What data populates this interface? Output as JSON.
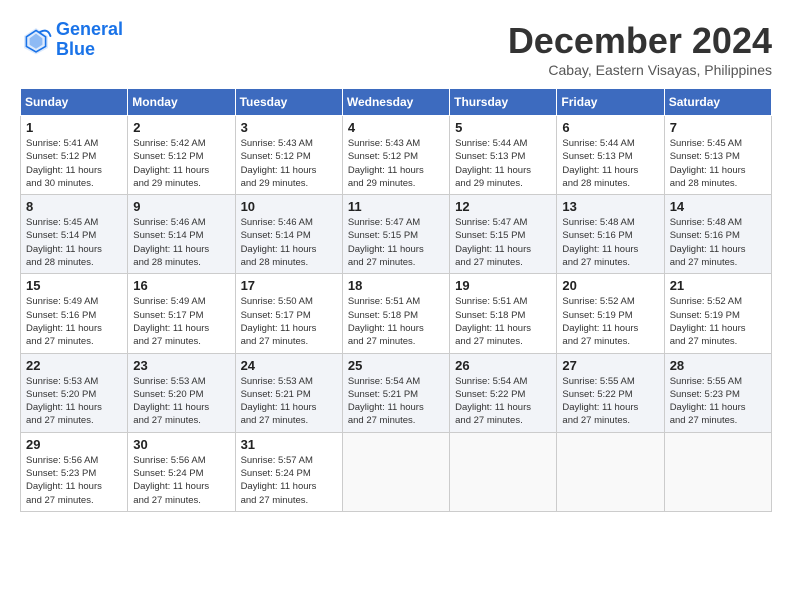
{
  "header": {
    "logo_line1": "General",
    "logo_line2": "Blue",
    "month": "December 2024",
    "location": "Cabay, Eastern Visayas, Philippines"
  },
  "weekdays": [
    "Sunday",
    "Monday",
    "Tuesday",
    "Wednesday",
    "Thursday",
    "Friday",
    "Saturday"
  ],
  "weeks": [
    [
      {
        "day": "1",
        "sunrise": "Sunrise: 5:41 AM",
        "sunset": "Sunset: 5:12 PM",
        "daylight": "Daylight: 11 hours and 30 minutes."
      },
      {
        "day": "2",
        "sunrise": "Sunrise: 5:42 AM",
        "sunset": "Sunset: 5:12 PM",
        "daylight": "Daylight: 11 hours and 29 minutes."
      },
      {
        "day": "3",
        "sunrise": "Sunrise: 5:43 AM",
        "sunset": "Sunset: 5:12 PM",
        "daylight": "Daylight: 11 hours and 29 minutes."
      },
      {
        "day": "4",
        "sunrise": "Sunrise: 5:43 AM",
        "sunset": "Sunset: 5:12 PM",
        "daylight": "Daylight: 11 hours and 29 minutes."
      },
      {
        "day": "5",
        "sunrise": "Sunrise: 5:44 AM",
        "sunset": "Sunset: 5:13 PM",
        "daylight": "Daylight: 11 hours and 29 minutes."
      },
      {
        "day": "6",
        "sunrise": "Sunrise: 5:44 AM",
        "sunset": "Sunset: 5:13 PM",
        "daylight": "Daylight: 11 hours and 28 minutes."
      },
      {
        "day": "7",
        "sunrise": "Sunrise: 5:45 AM",
        "sunset": "Sunset: 5:13 PM",
        "daylight": "Daylight: 11 hours and 28 minutes."
      }
    ],
    [
      {
        "day": "8",
        "sunrise": "Sunrise: 5:45 AM",
        "sunset": "Sunset: 5:14 PM",
        "daylight": "Daylight: 11 hours and 28 minutes."
      },
      {
        "day": "9",
        "sunrise": "Sunrise: 5:46 AM",
        "sunset": "Sunset: 5:14 PM",
        "daylight": "Daylight: 11 hours and 28 minutes."
      },
      {
        "day": "10",
        "sunrise": "Sunrise: 5:46 AM",
        "sunset": "Sunset: 5:14 PM",
        "daylight": "Daylight: 11 hours and 28 minutes."
      },
      {
        "day": "11",
        "sunrise": "Sunrise: 5:47 AM",
        "sunset": "Sunset: 5:15 PM",
        "daylight": "Daylight: 11 hours and 27 minutes."
      },
      {
        "day": "12",
        "sunrise": "Sunrise: 5:47 AM",
        "sunset": "Sunset: 5:15 PM",
        "daylight": "Daylight: 11 hours and 27 minutes."
      },
      {
        "day": "13",
        "sunrise": "Sunrise: 5:48 AM",
        "sunset": "Sunset: 5:16 PM",
        "daylight": "Daylight: 11 hours and 27 minutes."
      },
      {
        "day": "14",
        "sunrise": "Sunrise: 5:48 AM",
        "sunset": "Sunset: 5:16 PM",
        "daylight": "Daylight: 11 hours and 27 minutes."
      }
    ],
    [
      {
        "day": "15",
        "sunrise": "Sunrise: 5:49 AM",
        "sunset": "Sunset: 5:16 PM",
        "daylight": "Daylight: 11 hours and 27 minutes."
      },
      {
        "day": "16",
        "sunrise": "Sunrise: 5:49 AM",
        "sunset": "Sunset: 5:17 PM",
        "daylight": "Daylight: 11 hours and 27 minutes."
      },
      {
        "day": "17",
        "sunrise": "Sunrise: 5:50 AM",
        "sunset": "Sunset: 5:17 PM",
        "daylight": "Daylight: 11 hours and 27 minutes."
      },
      {
        "day": "18",
        "sunrise": "Sunrise: 5:51 AM",
        "sunset": "Sunset: 5:18 PM",
        "daylight": "Daylight: 11 hours and 27 minutes."
      },
      {
        "day": "19",
        "sunrise": "Sunrise: 5:51 AM",
        "sunset": "Sunset: 5:18 PM",
        "daylight": "Daylight: 11 hours and 27 minutes."
      },
      {
        "day": "20",
        "sunrise": "Sunrise: 5:52 AM",
        "sunset": "Sunset: 5:19 PM",
        "daylight": "Daylight: 11 hours and 27 minutes."
      },
      {
        "day": "21",
        "sunrise": "Sunrise: 5:52 AM",
        "sunset": "Sunset: 5:19 PM",
        "daylight": "Daylight: 11 hours and 27 minutes."
      }
    ],
    [
      {
        "day": "22",
        "sunrise": "Sunrise: 5:53 AM",
        "sunset": "Sunset: 5:20 PM",
        "daylight": "Daylight: 11 hours and 27 minutes."
      },
      {
        "day": "23",
        "sunrise": "Sunrise: 5:53 AM",
        "sunset": "Sunset: 5:20 PM",
        "daylight": "Daylight: 11 hours and 27 minutes."
      },
      {
        "day": "24",
        "sunrise": "Sunrise: 5:53 AM",
        "sunset": "Sunset: 5:21 PM",
        "daylight": "Daylight: 11 hours and 27 minutes."
      },
      {
        "day": "25",
        "sunrise": "Sunrise: 5:54 AM",
        "sunset": "Sunset: 5:21 PM",
        "daylight": "Daylight: 11 hours and 27 minutes."
      },
      {
        "day": "26",
        "sunrise": "Sunrise: 5:54 AM",
        "sunset": "Sunset: 5:22 PM",
        "daylight": "Daylight: 11 hours and 27 minutes."
      },
      {
        "day": "27",
        "sunrise": "Sunrise: 5:55 AM",
        "sunset": "Sunset: 5:22 PM",
        "daylight": "Daylight: 11 hours and 27 minutes."
      },
      {
        "day": "28",
        "sunrise": "Sunrise: 5:55 AM",
        "sunset": "Sunset: 5:23 PM",
        "daylight": "Daylight: 11 hours and 27 minutes."
      }
    ],
    [
      {
        "day": "29",
        "sunrise": "Sunrise: 5:56 AM",
        "sunset": "Sunset: 5:23 PM",
        "daylight": "Daylight: 11 hours and 27 minutes."
      },
      {
        "day": "30",
        "sunrise": "Sunrise: 5:56 AM",
        "sunset": "Sunset: 5:24 PM",
        "daylight": "Daylight: 11 hours and 27 minutes."
      },
      {
        "day": "31",
        "sunrise": "Sunrise: 5:57 AM",
        "sunset": "Sunset: 5:24 PM",
        "daylight": "Daylight: 11 hours and 27 minutes."
      },
      null,
      null,
      null,
      null
    ]
  ]
}
